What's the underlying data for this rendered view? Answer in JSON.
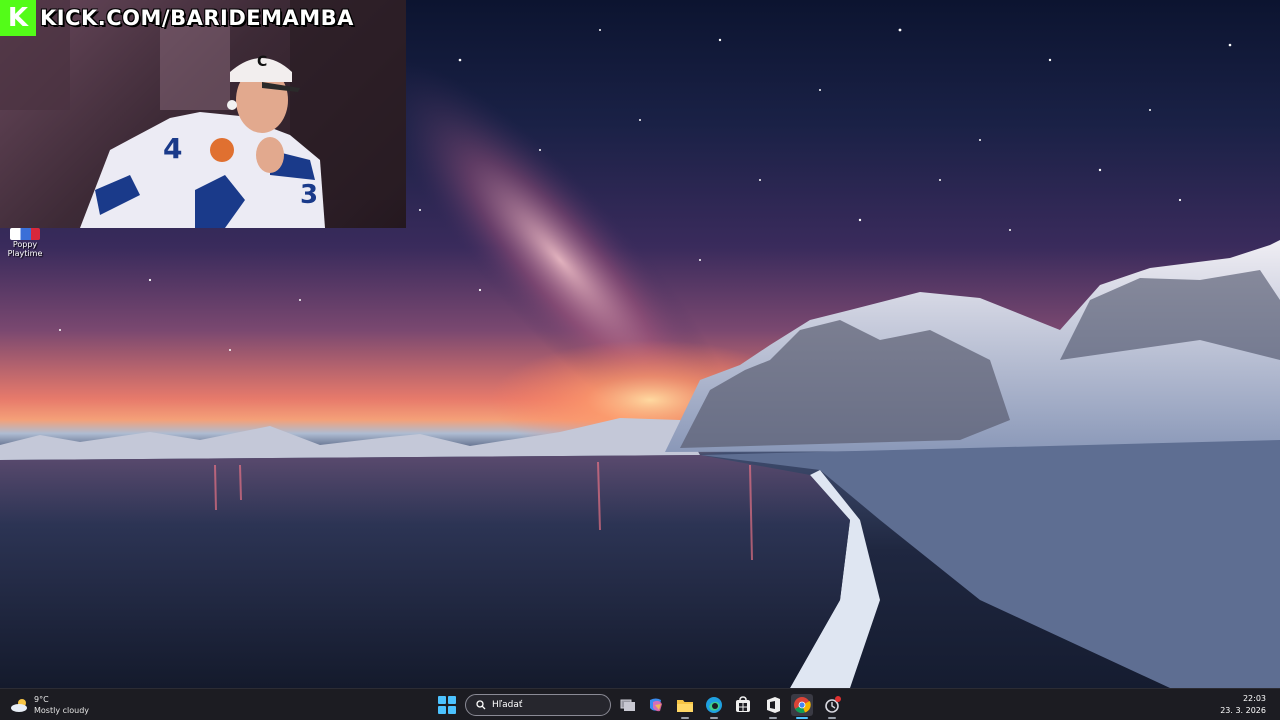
{
  "overlay": {
    "kick_logo": "K",
    "kick_url": "KICK.COM/BARIDEMAMBA",
    "jersey_numbers": [
      "4",
      "3"
    ],
    "cap_letter": "C"
  },
  "desktop": {
    "icons": [
      {
        "line1": "Poppy",
        "line2": "Playtime",
        "icon": "poppy-playtime-icon"
      }
    ]
  },
  "taskbar": {
    "weather": {
      "temp": "9°C",
      "condition": "Mostly cloudy",
      "icon": "partly-cloudy-icon"
    },
    "search_placeholder": "Hľadať",
    "apps": [
      {
        "name": "task-view",
        "icon": "task-view-icon"
      },
      {
        "name": "copilot",
        "icon": "copilot-icon"
      },
      {
        "name": "file-explorer",
        "icon": "folder-icon"
      },
      {
        "name": "edge",
        "icon": "edge-icon"
      },
      {
        "name": "microsoft-store",
        "icon": "store-icon"
      },
      {
        "name": "office",
        "icon": "office-icon"
      },
      {
        "name": "chrome",
        "icon": "chrome-icon",
        "active": true
      },
      {
        "name": "app-with-badge",
        "icon": "notification-app-icon"
      }
    ],
    "clock": {
      "time": "22:03",
      "date": "23. 3. 2026"
    }
  },
  "colors": {
    "kick_green": "#53fc18",
    "taskbar_bg": "#1c1c22",
    "accent": "#4cc2ff"
  }
}
